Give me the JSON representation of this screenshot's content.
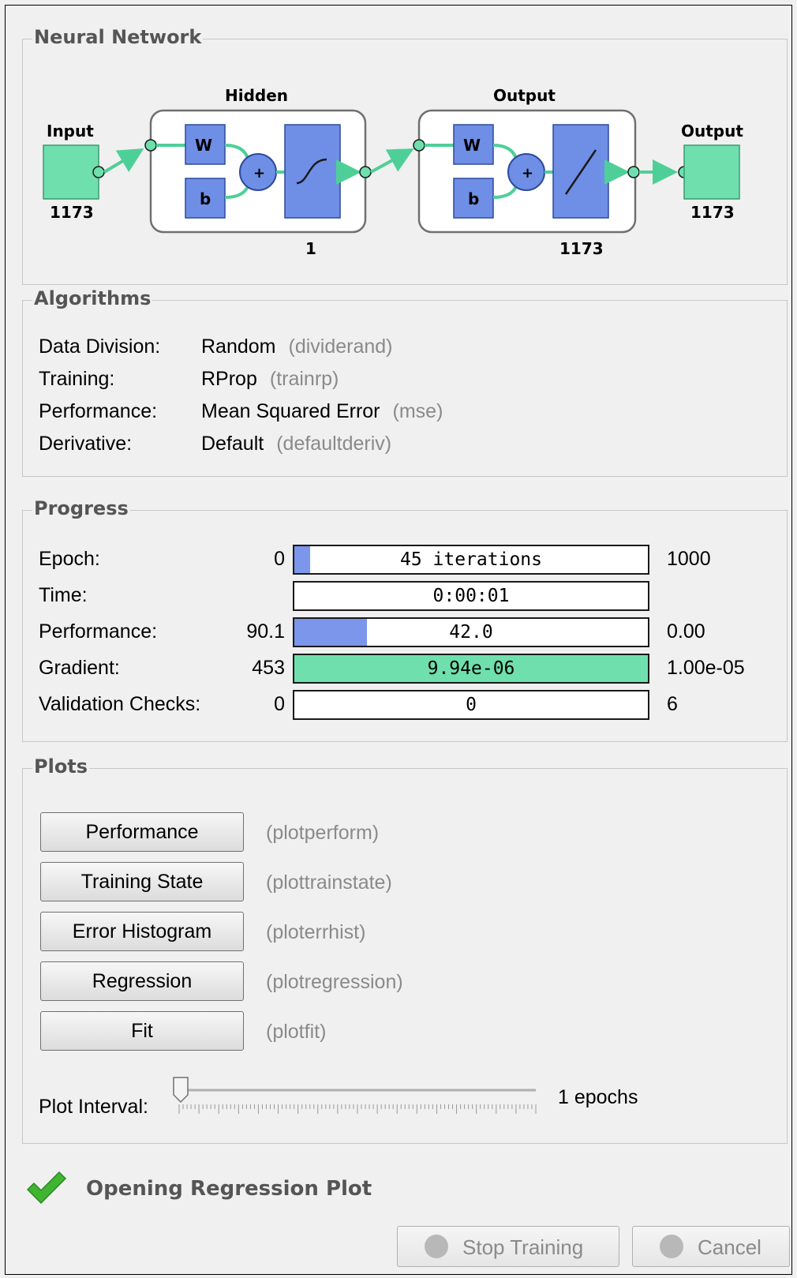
{
  "neural_network": {
    "title": "Neural Network",
    "input_label": "Input",
    "input_size": "1173",
    "hidden_label": "Hidden",
    "hidden_w": "W",
    "hidden_b": "b",
    "hidden_plus": "+",
    "hidden_size": "1",
    "output_layer_label": "Output",
    "output_w": "W",
    "output_b": "b",
    "output_plus": "+",
    "output_layer_size": "1173",
    "output_label": "Output",
    "output_size": "1173"
  },
  "algorithms": {
    "title": "Algorithms",
    "rows": [
      {
        "label": "Data Division:",
        "value": "Random",
        "fn": "(dividerand)"
      },
      {
        "label": "Training:",
        "value": "RProp",
        "fn": "(trainrp)"
      },
      {
        "label": "Performance:",
        "value": "Mean Squared Error",
        "fn": "(mse)"
      },
      {
        "label": "Derivative:",
        "value": "Default",
        "fn": "(defaultderiv)"
      }
    ]
  },
  "progress": {
    "title": "Progress",
    "rows": [
      {
        "label": "Epoch:",
        "min": "0",
        "text": "45 iterations",
        "max": "1000",
        "fill": 0.045,
        "color": "#7b96ea"
      },
      {
        "label": "Time:",
        "min": "",
        "text": "0:00:01",
        "max": "",
        "fill": 0,
        "color": "#7b96ea"
      },
      {
        "label": "Performance:",
        "min": "90.1",
        "text": "42.0",
        "max": "0.00",
        "fill": 0.205,
        "color": "#7b96ea"
      },
      {
        "label": "Gradient:",
        "min": "453",
        "text": "9.94e-06",
        "max": "1.00e-05",
        "fill": 1.0,
        "color": "#6fe0ad"
      },
      {
        "label": "Validation Checks:",
        "min": "0",
        "text": "0",
        "max": "6",
        "fill": 0,
        "color": "#7b96ea"
      }
    ]
  },
  "plots": {
    "title": "Plots",
    "buttons": [
      {
        "label": "Performance",
        "fn": "(plotperform)"
      },
      {
        "label": "Training State",
        "fn": "(plottrainstate)"
      },
      {
        "label": "Error Histogram",
        "fn": "(ploterrhist)"
      },
      {
        "label": "Regression",
        "fn": "(plotregression)"
      },
      {
        "label": "Fit",
        "fn": "(plotfit)"
      }
    ],
    "interval_label": "Plot Interval:",
    "interval_value": "1 epochs",
    "slider_value": 1
  },
  "status": {
    "icon": "checkmark-icon",
    "text": "Opening Regression Plot"
  },
  "buttons": {
    "stop_training": "Stop Training",
    "cancel": "Cancel"
  },
  "colors": {
    "io_green": "#6fe0ad",
    "layer_blue": "#6f8fe6",
    "bar_blue": "#7b96ea",
    "bar_green": "#6fe0ad",
    "check_green": "#3fb531"
  }
}
